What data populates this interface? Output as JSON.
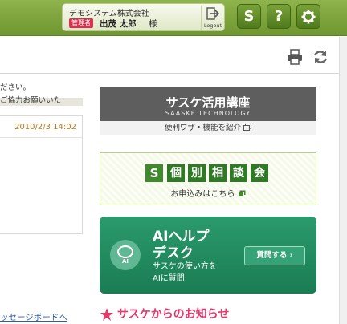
{
  "header": {
    "company": "デモシステム株式会社",
    "role_badge": "管理者",
    "user_name": "出茂 太郎",
    "honorific": "様",
    "logout_label": "Logout",
    "buttons": {
      "app_logo": "S",
      "help": "?"
    }
  },
  "left": {
    "date": "2010/2/3 14:02",
    "text_lines": [
      "ださい。",
      "ご協力お願いいた"
    ],
    "link": "ッセージボードへ"
  },
  "banners": {
    "seminar": {
      "title": "サスケ活用講座",
      "subtitle": "SAASKE TECHNOLOGY",
      "footer": "便利ワザ・機能を紹介"
    },
    "consult": {
      "logo": "S",
      "chars": [
        "個",
        "別",
        "相",
        "談",
        "会"
      ],
      "sub": "お申込みはこちら"
    },
    "ai": {
      "badge": "AI",
      "title_line1": "AIヘルプ",
      "title_line2": "デスク",
      "desc_line1": "サスケの使い方を",
      "desc_line2": "AIに質問",
      "button": "質問する ›"
    }
  },
  "news": {
    "title": "サスケからのお知らせ"
  },
  "colors": {
    "header_green": "#7aa23a",
    "role_red": "#d9304f",
    "ai_green": "#1b7c54",
    "news_pink": "#e5386b",
    "date_orange": "#b9771b"
  }
}
